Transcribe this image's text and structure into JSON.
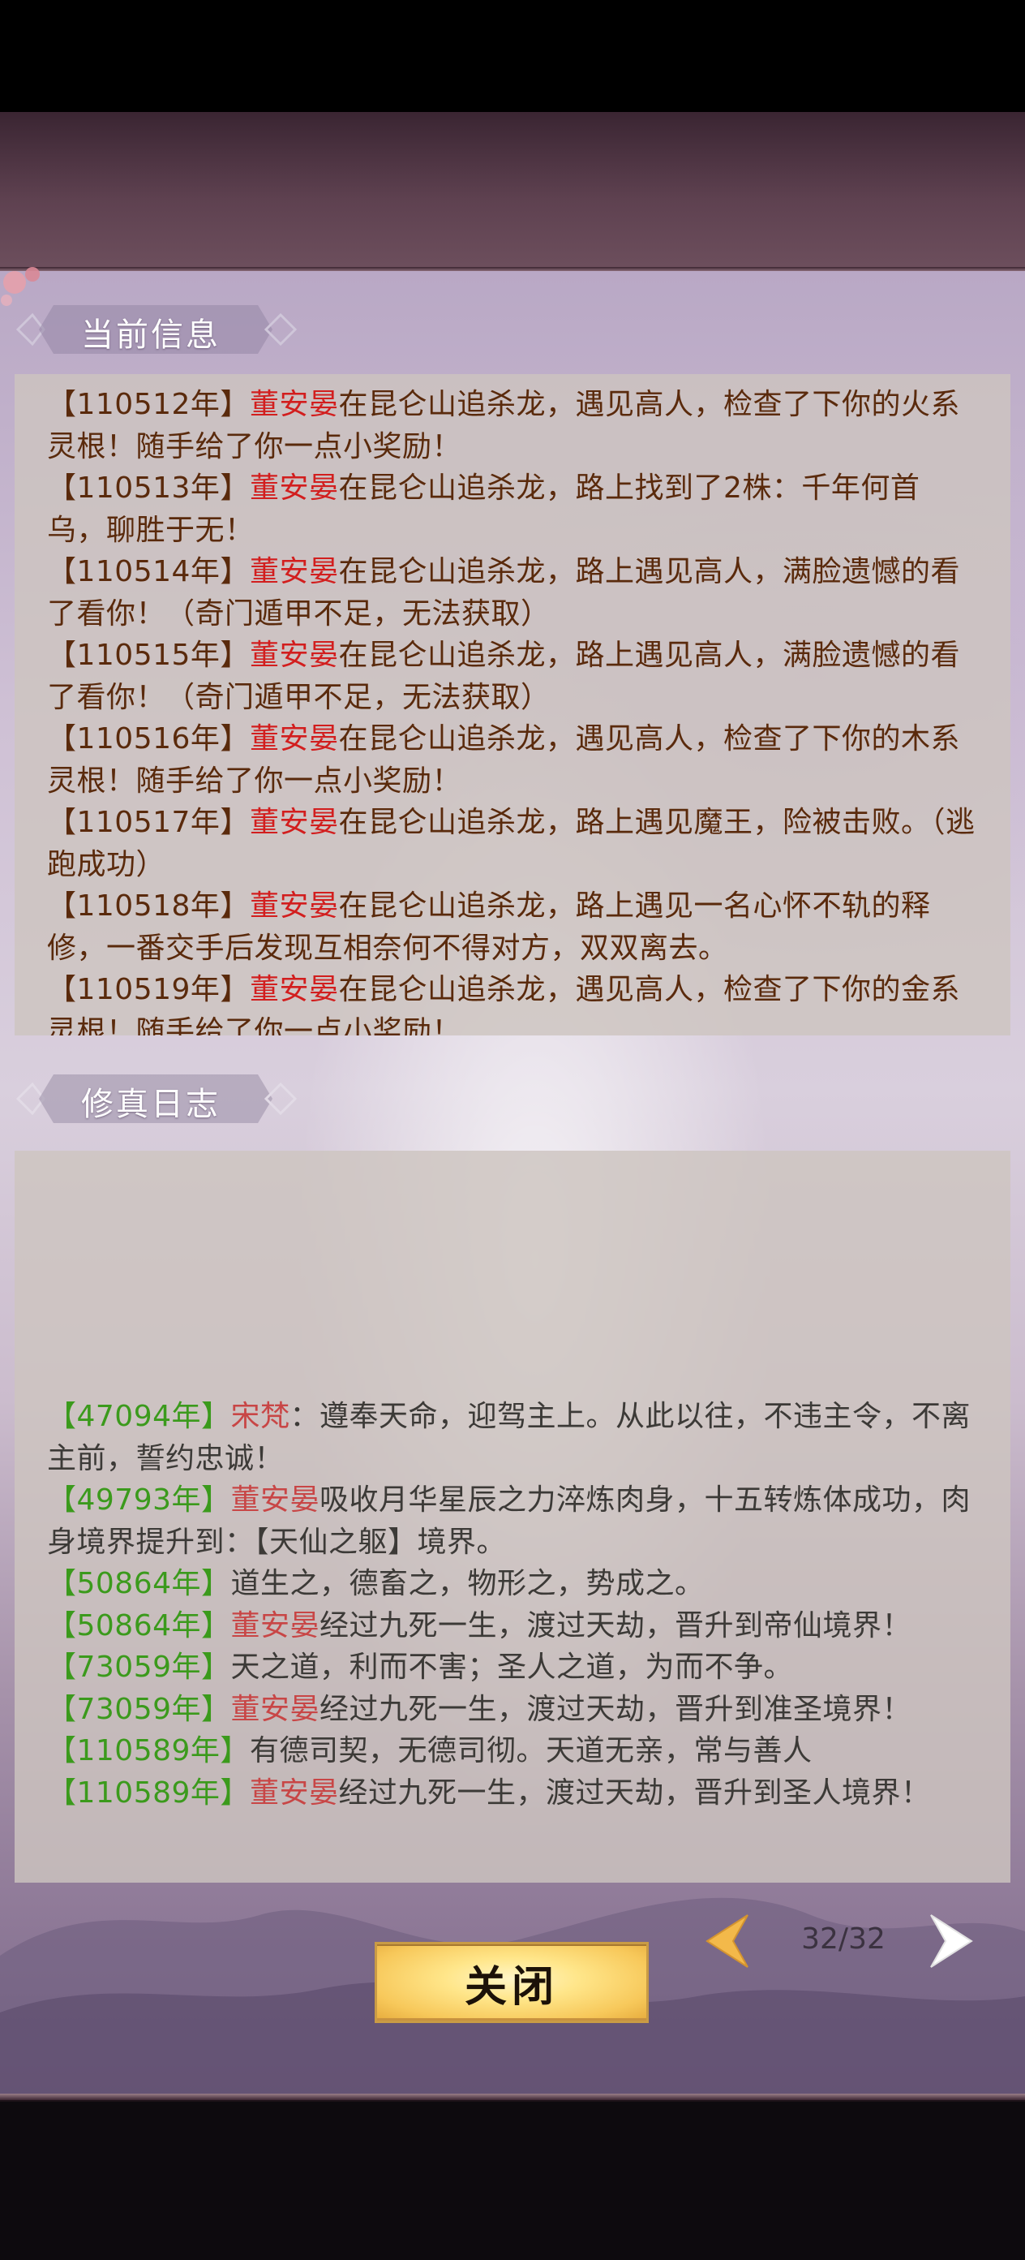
{
  "sections": {
    "info_title": "当前信息",
    "log_title": "修真日志"
  },
  "info_entries": [
    {
      "year": "【110512年】",
      "name": "董安晏",
      "text": "在昆仑山追杀龙，遇见高人，检查了下你的火系灵根！随手给了你一点小奖励！"
    },
    {
      "year": "【110513年】",
      "name": "董安晏",
      "text": "在昆仑山追杀龙，路上找到了2株：千年何首乌，聊胜于无！"
    },
    {
      "year": "【110514年】",
      "name": "董安晏",
      "text": "在昆仑山追杀龙，路上遇见高人，满脸遗憾的看了看你！（奇门遁甲不足，无法获取）"
    },
    {
      "year": "【110515年】",
      "name": "董安晏",
      "text": "在昆仑山追杀龙，路上遇见高人，满脸遗憾的看了看你！（奇门遁甲不足，无法获取）"
    },
    {
      "year": "【110516年】",
      "name": "董安晏",
      "text": "在昆仑山追杀龙，遇见高人，检查了下你的木系灵根！随手给了你一点小奖励！"
    },
    {
      "year": "【110517年】",
      "name": "董安晏",
      "text": "在昆仑山追杀龙，路上遇见魔王，险被击败。（逃跑成功）"
    },
    {
      "year": "【110518年】",
      "name": "董安晏",
      "text": "在昆仑山追杀龙，路上遇见一名心怀不轨的释修，一番交手后发现互相奈何不得对方，双双离去。"
    },
    {
      "year": "【110519年】",
      "name": "董安晏",
      "text": "在昆仑山追杀龙，遇见高人，检查了下你的金系灵根！随手给了你一点小奖励！"
    }
  ],
  "log_entries": [
    {
      "year": "【47094年】",
      "name": "宋梵",
      "text": "：遵奉天命，迎驾主上。从此以往，不违主令，不离主前，誓约忠诚！"
    },
    {
      "year": "【49793年】",
      "name": "董安晏",
      "text": "吸收月华星辰之力淬炼肉身，十五转炼体成功，肉身境界提升到：【天仙之躯】境界。"
    },
    {
      "year": "【50864年】",
      "name": "",
      "text": "道生之，德畜之，物形之，势成之。"
    },
    {
      "year": "【50864年】",
      "name": "董安晏",
      "text": "经过九死一生，渡过天劫，晋升到帝仙境界！"
    },
    {
      "year": "【73059年】",
      "name": "",
      "text": "天之道，利而不害；圣人之道，为而不争。"
    },
    {
      "year": "【73059年】",
      "name": "董安晏",
      "text": "经过九死一生，渡过天劫，晋升到准圣境界！"
    },
    {
      "year": "【110589年】",
      "name": "",
      "text": "有德司契，无德司彻。天道无亲，常与善人"
    },
    {
      "year": "【110589年】",
      "name": "董安晏",
      "text": "经过九死一生，渡过天劫，晋升到圣人境界！"
    }
  ],
  "footer": {
    "close_label": "关闭",
    "page_indicator": "32/32"
  },
  "colors": {
    "info_text": "#5a2a0c",
    "info_name": "#d21e1e",
    "log_year": "#3b9a1c",
    "log_name": "#c84646",
    "button_gold": "#f7c85a"
  },
  "icons": {
    "prev": "chevron-left-icon",
    "next": "chevron-right-icon"
  }
}
